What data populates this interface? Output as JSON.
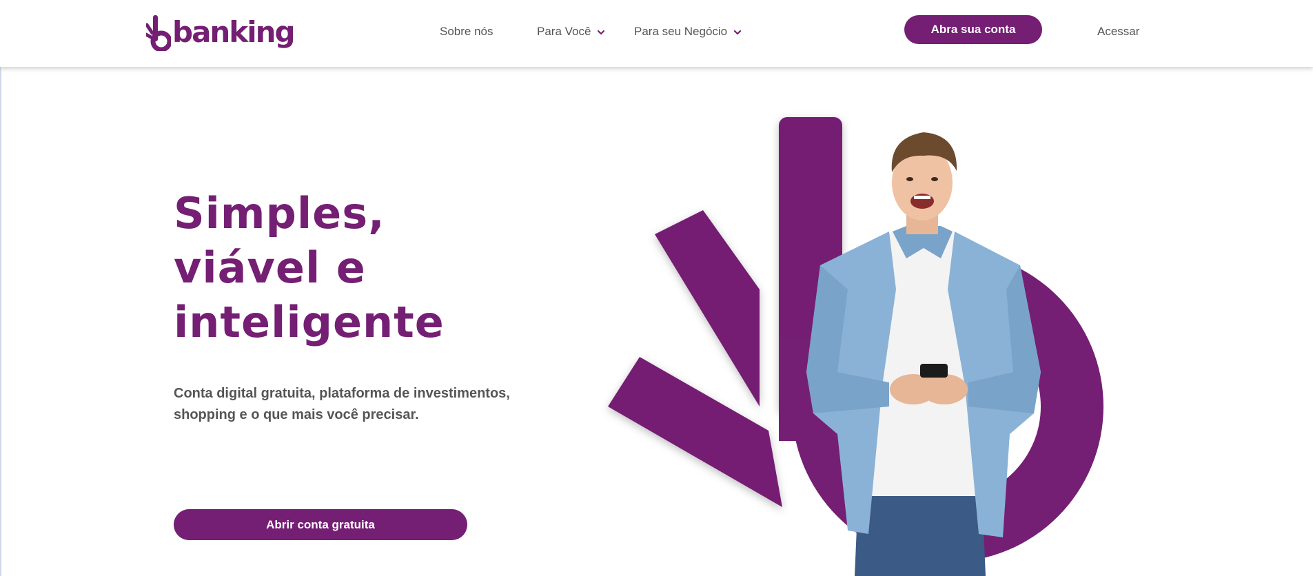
{
  "brand": {
    "name": "banking",
    "color": "#741f73",
    "logo_icon": "b-burst-logo-icon"
  },
  "nav": {
    "items": [
      {
        "label": "Sobre nós",
        "dropdown": false
      },
      {
        "label": "Para Você",
        "dropdown": true,
        "icon": "chevron-down-icon"
      },
      {
        "label": "Para seu Negócio",
        "dropdown": true,
        "icon": "chevron-down-icon"
      }
    ],
    "cta_label": "Abra sua conta",
    "login_label": "Acessar"
  },
  "hero": {
    "title_lines": [
      "Simples,",
      "viável e",
      "inteligente"
    ],
    "subtitle_lines": [
      "Conta digital gratuita, plataforma de investimentos,",
      "shopping e o que mais você precisar."
    ],
    "cta_label": "Abrir conta gratuita",
    "image": "young-man-holding-phone-photo"
  },
  "colors": {
    "primary": "#741f73",
    "text_gray": "#555555",
    "background": "#ffffff"
  }
}
